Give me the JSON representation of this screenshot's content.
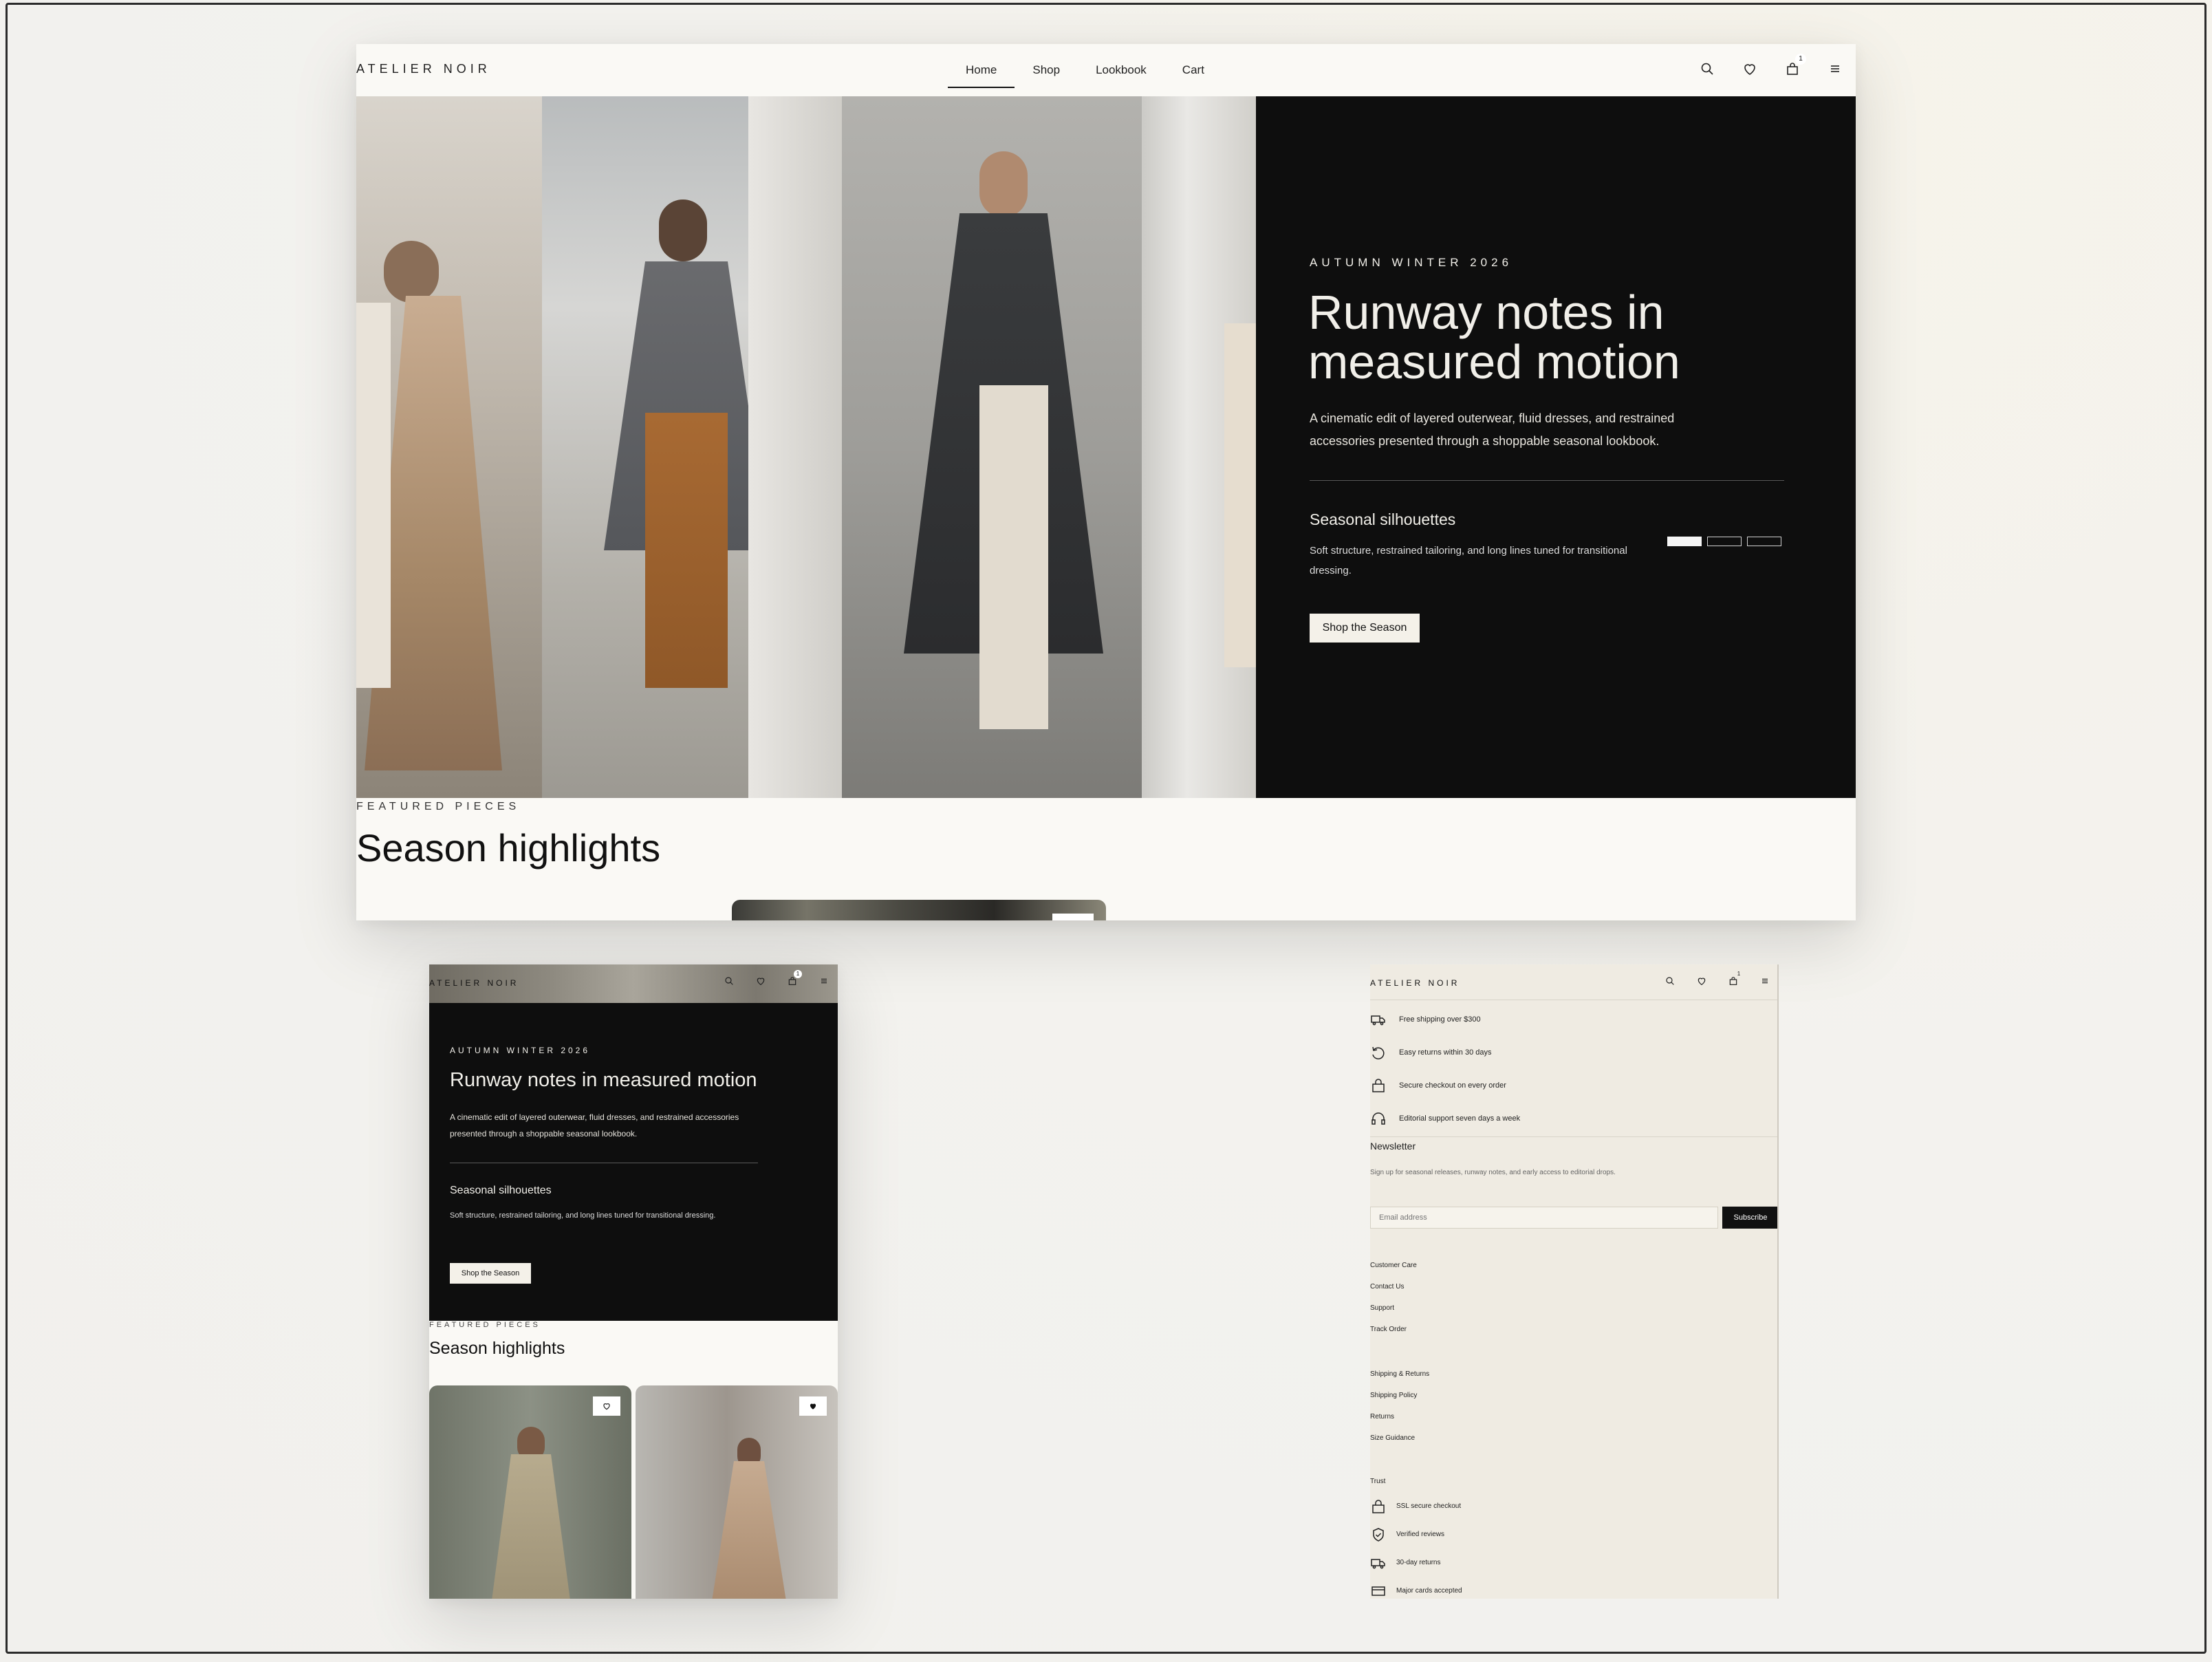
{
  "desktop": {
    "brand": "ATELIER NOIR",
    "nav": [
      "Home",
      "Shop",
      "Lookbook",
      "Cart"
    ],
    "cart_count": "1",
    "hero": {
      "kicker": "AUTUMN WINTER 2026",
      "title": "Runway notes in measured motion",
      "lead": "A cinematic edit of layered outerwear, fluid dresses, and restrained accessories presented through a shoppable seasonal lookbook.",
      "subhead": "Seasonal silhouettes",
      "subtext": "Soft structure, restrained tailoring, and long lines tuned for transitional dressing.",
      "cta": "Shop the Season",
      "slides": 3,
      "active_slide": 1
    },
    "featured_kicker": "FEATURED PIECES",
    "featured_title": "Season highlights"
  },
  "mobile_left": {
    "brand": "ATELIER NOIR",
    "cart_count": "1",
    "kicker": "AUTUMN WINTER 2026",
    "title": "Runway notes in measured motion",
    "lead": "A cinematic edit of layered outerwear, fluid dresses, and restrained accessories presented through a shoppable seasonal lookbook.",
    "subhead": "Seasonal silhouettes",
    "subtext": "Soft structure, restrained tailoring, and long lines tuned for transitional dressing.",
    "cta": "Shop the Season",
    "featured_kicker": "FEATURED PIECES",
    "featured_title": "Season highlights"
  },
  "mobile_right": {
    "brand": "ATELIER NOIR",
    "cart_count": "1",
    "perks": [
      {
        "icon": "truck-icon",
        "label": "Free shipping over $300"
      },
      {
        "icon": "return-icon",
        "label": "Easy returns within 30 days"
      },
      {
        "icon": "lock-icon",
        "label": "Secure checkout on every order"
      },
      {
        "icon": "headset-icon",
        "label": "Editorial support seven days a week"
      }
    ],
    "newsletter": {
      "title": "Newsletter",
      "text": "Sign up for seasonal releases, runway notes, and early access to editorial drops.",
      "placeholder": "Email address",
      "button": "Subscribe"
    },
    "customer_care": [
      "Customer Care",
      "Contact Us",
      "Support",
      "Track Order"
    ],
    "shipping": [
      "Shipping & Returns",
      "Shipping Policy",
      "Returns",
      "Size Guidance"
    ],
    "trust_title": "Trust",
    "trust": [
      {
        "icon": "lock-icon",
        "label": "SSL secure checkout"
      },
      {
        "icon": "shield-icon",
        "label": "Verified reviews"
      },
      {
        "icon": "truck-icon",
        "label": "30-day returns"
      },
      {
        "icon": "card-icon",
        "label": "Major cards accepted"
      }
    ]
  }
}
